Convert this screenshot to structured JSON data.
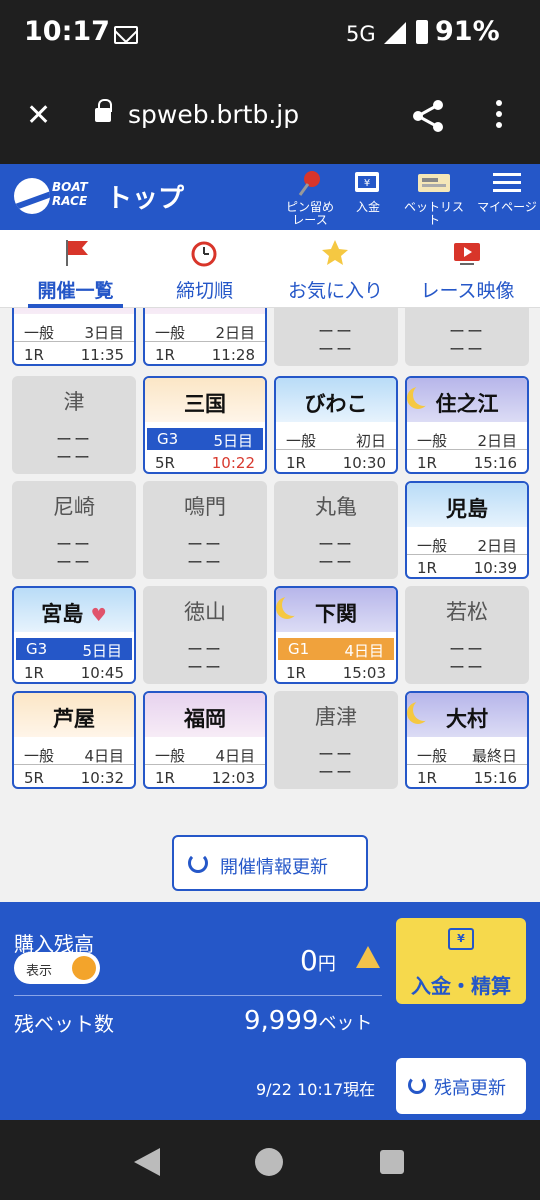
{
  "status": {
    "time": "10:17",
    "network": "5G",
    "battery": "91%"
  },
  "browser": {
    "url": "spweb.brtb.jp"
  },
  "header": {
    "title": "トップ",
    "logo": "BOAT RACE",
    "pin_label": "ピン留め\nレース",
    "deposit_label": "入金",
    "betlist_label": "ベットリスト",
    "mypage_label": "マイページ"
  },
  "tabs": [
    {
      "label": "開催一覧",
      "icon": "flag-icon"
    },
    {
      "label": "締切順",
      "icon": "alarm-clock-icon"
    },
    {
      "label": "お気に入り",
      "icon": "star-icon"
    },
    {
      "label": "レース映像",
      "icon": "video-icon"
    }
  ],
  "cards": [
    {
      "venue": "",
      "status": "open",
      "sky": "pink",
      "grade": "一般",
      "day": "3日目",
      "race": "1R",
      "time": "11:35"
    },
    {
      "venue": "",
      "status": "open",
      "sky": "pink",
      "grade": "一般",
      "day": "2日目",
      "race": "1R",
      "time": "11:28"
    },
    {
      "venue": "",
      "status": "closed",
      "dash": "ーー"
    },
    {
      "venue": "",
      "status": "closed",
      "dash": "ーー"
    },
    {
      "venue": "津",
      "status": "closed",
      "dash": "ーー"
    },
    {
      "venue": "三国",
      "status": "open",
      "sky": "day",
      "grade": "G3",
      "day": "5日目",
      "race": "5R",
      "time": "10:22",
      "time_red": true
    },
    {
      "venue": "びわこ",
      "status": "open",
      "sky": "blue",
      "grade": "一般",
      "day": "初日",
      "race": "1R",
      "time": "10:30"
    },
    {
      "venue": "住之江",
      "status": "open",
      "sky": "night",
      "grade": "一般",
      "day": "2日目",
      "race": "1R",
      "time": "15:16"
    },
    {
      "venue": "尼崎",
      "status": "closed",
      "dash": "ーー"
    },
    {
      "venue": "鳴門",
      "status": "closed",
      "dash": "ーー"
    },
    {
      "venue": "丸亀",
      "status": "closed",
      "dash": "ーー"
    },
    {
      "venue": "児島",
      "status": "open",
      "sky": "blue",
      "grade": "一般",
      "day": "2日目",
      "race": "1R",
      "time": "10:39"
    },
    {
      "venue": "宮島",
      "status": "open",
      "sky": "blue",
      "grade": "G3",
      "day": "5日目",
      "race": "1R",
      "time": "10:45",
      "favorite": true
    },
    {
      "venue": "徳山",
      "status": "closed",
      "dash": "ーー"
    },
    {
      "venue": "下関",
      "status": "open",
      "sky": "night",
      "grade": "G1",
      "day": "4日目",
      "race": "1R",
      "time": "15:03"
    },
    {
      "venue": "若松",
      "status": "closed",
      "dash": "ーー"
    },
    {
      "venue": "芦屋",
      "status": "open",
      "sky": "day",
      "grade": "一般",
      "day": "4日目",
      "race": "5R",
      "time": "10:32"
    },
    {
      "venue": "福岡",
      "status": "open",
      "sky": "pink",
      "grade": "一般",
      "day": "4日目",
      "race": "1R",
      "time": "12:03"
    },
    {
      "venue": "唐津",
      "status": "closed",
      "dash": "ーー"
    },
    {
      "venue": "大村",
      "status": "open",
      "sky": "night",
      "grade": "一般",
      "day": "最終日",
      "race": "1R",
      "time": "15:16"
    }
  ],
  "refresh_label": "開催情報更新",
  "balance": {
    "label": "購入残高",
    "toggle_label": "表示",
    "amount": "0",
    "amount_unit": "円",
    "bets_label": "残ベット数",
    "bets": "9,999",
    "bets_unit": "ベット",
    "as_of": "9/22 10:17現在",
    "deposit_label": "入金・精算",
    "refresh_label": "残高更新"
  },
  "colors": {
    "brand": "#2557c8",
    "g1": "#f0a23c",
    "deposit": "#f6d94c"
  }
}
